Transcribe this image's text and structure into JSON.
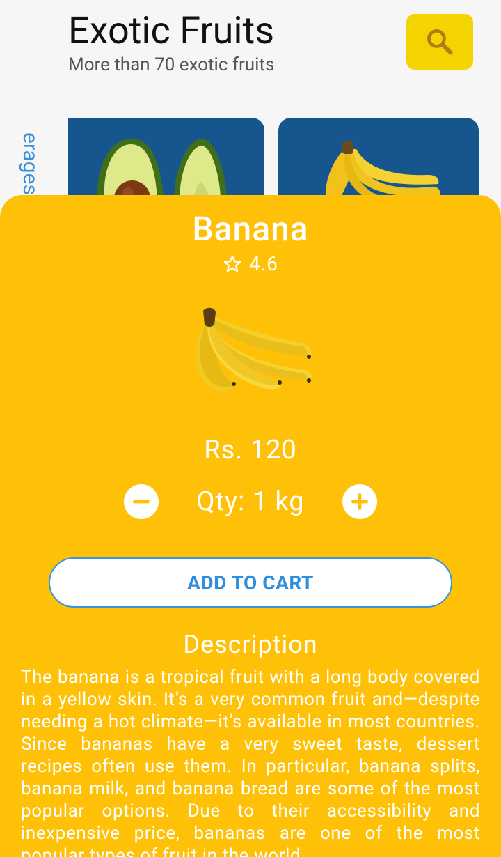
{
  "header": {
    "title": "Exotic Fruits",
    "subtitle": "More than 70 exotic fruits"
  },
  "sidebar": {
    "category_partial": "erages"
  },
  "icons": {
    "search": "search-icon",
    "rating": "star-outline-icon",
    "decrease": "minus-icon",
    "increase": "plus-icon"
  },
  "colors": {
    "sheet_background": "#ffc107",
    "search_button": "#f3d300",
    "card_background": "#17558e",
    "accent_blue": "#2f8fdc"
  },
  "product_cards": [
    {
      "fruit": "avocado"
    },
    {
      "fruit": "banana"
    }
  ],
  "detail": {
    "name": "Banana",
    "rating": "4.6",
    "price": "Rs. 120",
    "quantity": "Qty: 1 kg",
    "add_to_cart_label": "ADD TO CART",
    "description_title": "Description",
    "description": "The banana is a tropical fruit with a long body covered in a yellow skin.  It’s a very common fruit and—despite needing a hot climate—it’s available in most countries.  Since bananas have a very sweet taste, dessert recipes often use them.  In particular, banana splits, banana milk, and banana bread are some of the most popular options.  Due to their accessibility and inexpensive price, bananas are one of the most popular types of fruit in the world."
  }
}
